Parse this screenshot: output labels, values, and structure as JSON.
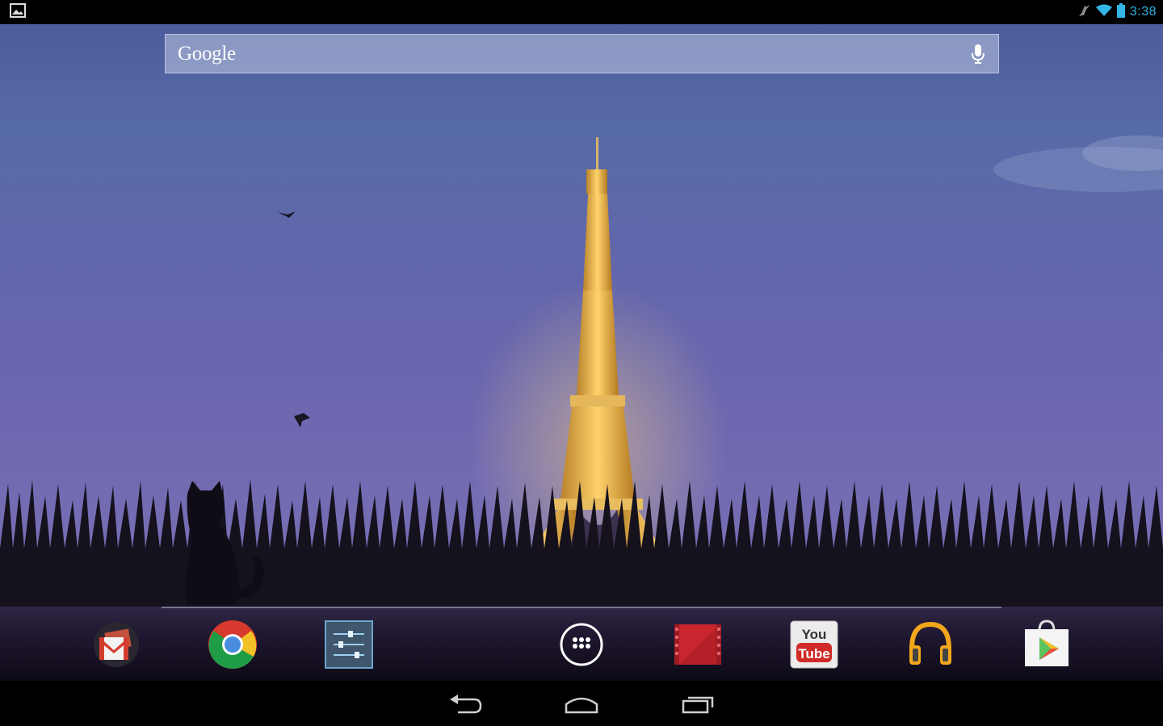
{
  "status_bar": {
    "time": "3:38",
    "icons": [
      "screenshot-notification-icon",
      "no-sound-icon",
      "wifi-icon",
      "battery-icon"
    ]
  },
  "search": {
    "logo_text": "Google",
    "icon": "mic-icon"
  },
  "dock": {
    "apps": [
      {
        "name": "Gmail",
        "icon": "gmail-icon"
      },
      {
        "name": "Chrome",
        "icon": "chrome-icon"
      },
      {
        "name": "Settings",
        "icon": "settings-icon"
      },
      {
        "name": "Apps",
        "icon": "all-apps-icon"
      },
      {
        "name": "Play Movies",
        "icon": "play-movies-icon"
      },
      {
        "name": "YouTube",
        "icon": "youtube-icon",
        "label_top": "You",
        "label_bottom": "Tube"
      },
      {
        "name": "Play Music",
        "icon": "play-music-icon"
      },
      {
        "name": "Play Store",
        "icon": "play-store-icon"
      }
    ]
  },
  "nav": {
    "buttons": [
      "back-icon",
      "home-icon",
      "recents-icon"
    ]
  },
  "colors": {
    "accent": "#33b5e5",
    "sky_top": "#4d5c9c",
    "sky_bottom": "#7a72b6",
    "tower_light": "#f2c45a"
  }
}
